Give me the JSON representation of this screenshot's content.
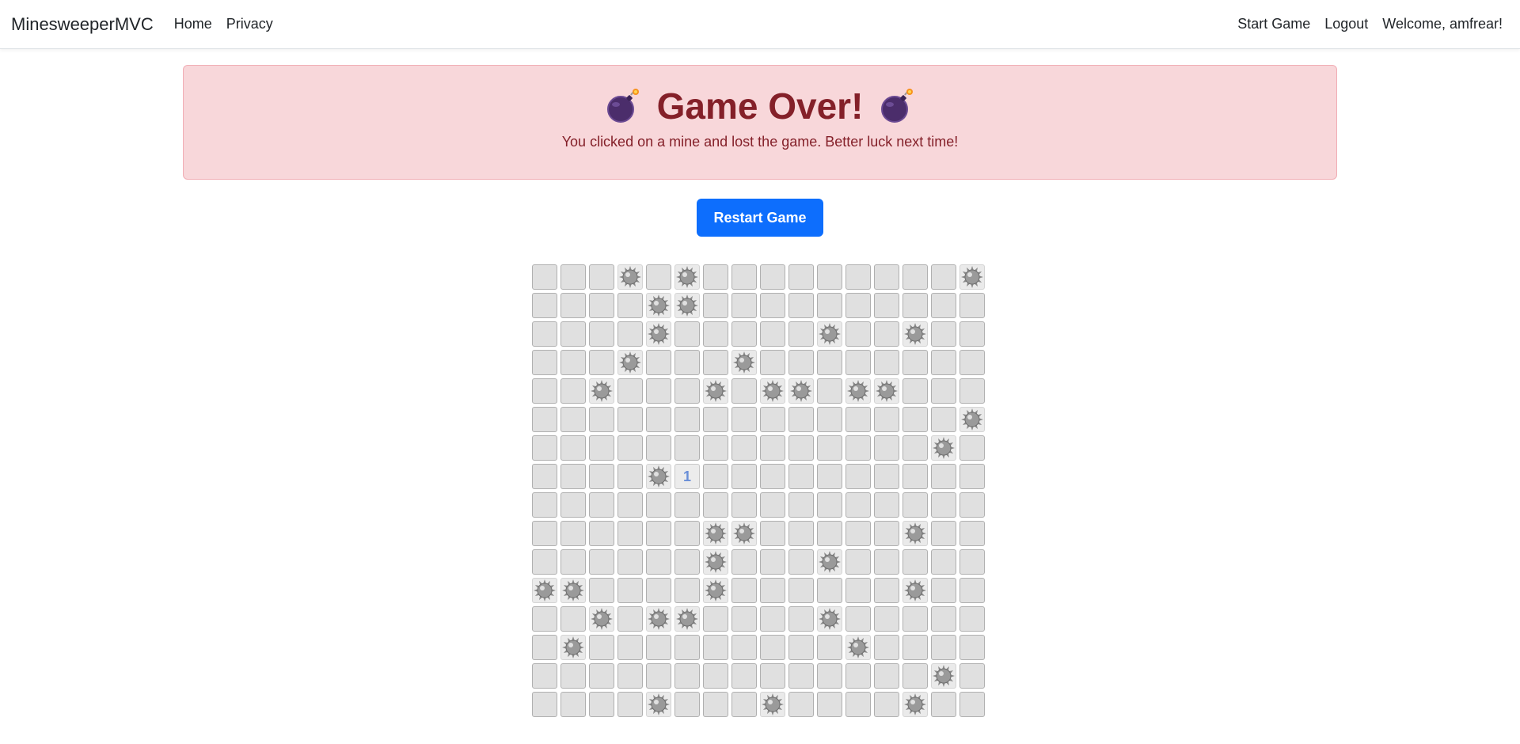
{
  "nav": {
    "brand": "MinesweeperMVC",
    "home": "Home",
    "privacy": "Privacy",
    "start_game": "Start Game",
    "logout": "Logout",
    "welcome": "Welcome, amfrear!"
  },
  "alert": {
    "title": "Game Over!",
    "message": "You clicked on a mine and lost the game. Better luck next time!",
    "icon": "bomb-icon"
  },
  "restart_button": "Restart Game",
  "colors": {
    "alert_bg": "#f8d7da",
    "alert_text": "#842029",
    "primary": "#0d6efd",
    "cell": "#e0e0e0",
    "number_1": "#6a8fd8"
  },
  "board": {
    "rows": 16,
    "cols": 16,
    "mine_icon": "mine-icon",
    "grid": [
      "...*.*.........*.",
      "....**..........",
      "....*.....*..*...",
      "...*...*........",
      "..*...*.**.**...",
      "...............*",
      "..............*.",
      "....*1..........",
      "................",
      "......**.....*..",
      "......*...*.....",
      "**....*......*..",
      "..*.**....*.....",
      ".*.........*....",
      "..............*.",
      "....*...*....*.."
    ]
  }
}
